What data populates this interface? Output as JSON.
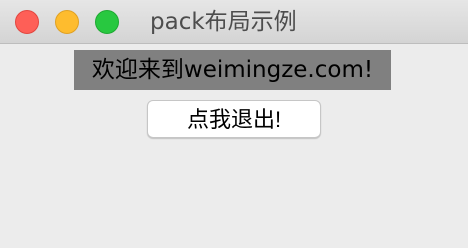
{
  "window": {
    "title": "pack布局示例",
    "controls": {
      "close": {
        "icon": "close-circle-icon",
        "color": "#fe5f57"
      },
      "minimize": {
        "icon": "minimize-circle-icon",
        "color": "#febc2e"
      },
      "zoom": {
        "icon": "zoom-circle-icon",
        "color": "#28c840"
      }
    }
  },
  "content": {
    "welcome_label": "欢迎来到weimingze.com!",
    "welcome_background": "#808080",
    "quit_button_label": "点我退出!"
  }
}
